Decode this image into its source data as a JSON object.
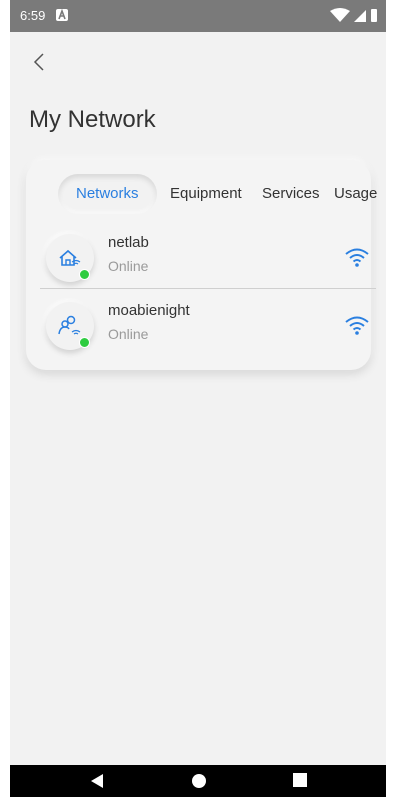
{
  "status_bar": {
    "time": "6:59",
    "notification_icon": "a-notification-icon",
    "icons": [
      "wifi-signal-icon",
      "cell-signal-icon",
      "battery-icon"
    ]
  },
  "header": {
    "back_icon": "chevron-left-icon",
    "title": "My Network"
  },
  "tabs": [
    {
      "label": "Networks",
      "active": true
    },
    {
      "label": "Equipment",
      "active": false
    },
    {
      "label": "Services",
      "active": false
    },
    {
      "label": "Usage",
      "active": false
    }
  ],
  "networks": [
    {
      "name": "netlab",
      "status": "Online",
      "icon": "home-wifi-icon",
      "signal_icon": "wifi-icon"
    },
    {
      "name": "moabienight",
      "status": "Online",
      "icon": "people-wifi-icon",
      "signal_icon": "wifi-icon"
    }
  ],
  "colors": {
    "accent": "#2a7fe0",
    "online_dot": "#2ecc40",
    "background": "#f2f2f2",
    "status_bar": "#7a7a7a"
  },
  "nav_bar": [
    "back-triangle-icon",
    "home-circle-icon",
    "recents-square-icon"
  ]
}
